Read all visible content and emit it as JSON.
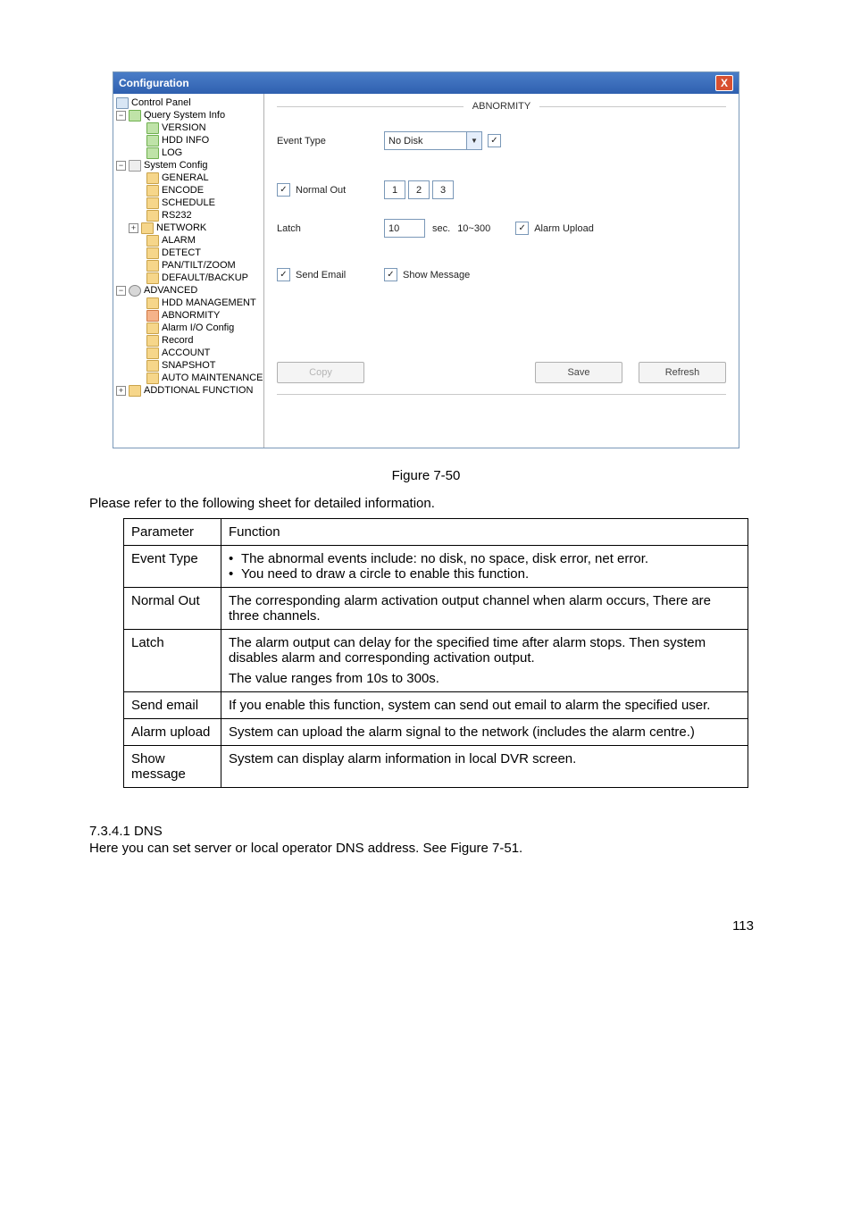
{
  "dialog": {
    "title": "Configuration",
    "close_icon": "X",
    "tree": {
      "root": "Control Panel",
      "query_info": "Query System Info",
      "version": "VERSION",
      "hdd_info": "HDD INFO",
      "log": "LOG",
      "system_config": "System Config",
      "general": "GENERAL",
      "encode": "ENCODE",
      "schedule": "SCHEDULE",
      "rs232": "RS232",
      "network": "NETWORK",
      "alarm": "ALARM",
      "detect": "DETECT",
      "ptz": "PAN/TILT/ZOOM",
      "default_backup": "DEFAULT/BACKUP",
      "advanced": "ADVANCED",
      "hdd_mgmt": "HDD MANAGEMENT",
      "abnormity": "ABNORMITY",
      "alarm_io": "Alarm I/O Config",
      "record": "Record",
      "account": "ACCOUNT",
      "snapshot": "SNAPSHOT",
      "auto_maint": "AUTO MAINTENANCE",
      "add_func": "ADDTIONAL FUNCTION"
    },
    "panel": {
      "heading": "ABNORMITY",
      "event_type_label": "Event Type",
      "event_type_value": "No Disk",
      "normal_out_label": "Normal Out",
      "channels": [
        "1",
        "2",
        "3"
      ],
      "latch_label": "Latch",
      "latch_value": "10",
      "latch_unit": "sec.",
      "latch_range": "10~300",
      "alarm_upload_label": "Alarm Upload",
      "send_email_label": "Send Email",
      "show_message_label": "Show Message",
      "copy": "Copy",
      "save": "Save",
      "refresh": "Refresh"
    }
  },
  "figure_caption": "Figure 7-50",
  "intro_para": "Please refer to the following sheet for detailed information.",
  "table": {
    "header_param": "Parameter",
    "header_func": "Function",
    "rows": {
      "event_type_p": "Event Type",
      "event_type_b1": "The abnormal events include: no disk, no space, disk error, net error.",
      "event_type_b2": "You need to draw a circle to enable this function.",
      "normal_out_p": "Normal Out",
      "normal_out_f": "The corresponding alarm activation output channel when alarm occurs, There are three channels.",
      "latch_p": "Latch",
      "latch_f1": "The alarm output can delay for the specified time after alarm stops. Then system disables alarm and corresponding activation output.",
      "latch_f2": "The value ranges from 10s to 300s.",
      "send_email_p": "Send email",
      "send_email_f": "If you enable this function, system can send out email to alarm the specified user.",
      "alarm_upload_p": "Alarm upload",
      "alarm_upload_f": "System can upload the alarm signal to the network (includes the alarm centre.)",
      "show_msg_p": "Show message",
      "show_msg_f": "System can display alarm information in local DVR screen."
    }
  },
  "section": {
    "number_title": "7.3.4.1  DNS",
    "body": "Here you can set server or local operator DNS address. See Figure 7-51."
  },
  "page_number": "113"
}
